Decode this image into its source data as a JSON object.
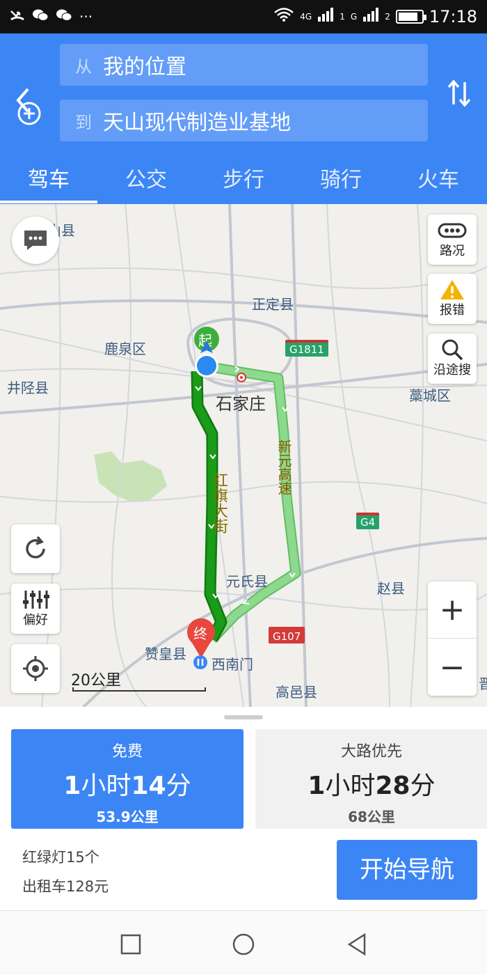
{
  "status_bar": {
    "left_icons": [
      "missed-call-icon",
      "wechat-icon",
      "wechat-icon",
      "more-dots-icon"
    ],
    "more": "···",
    "net1": "4G",
    "net2": "G",
    "sim1": "1",
    "sim2": "2",
    "battery_level": 0.85,
    "time": "17:18"
  },
  "header": {
    "from_prefix": "从",
    "from_value": "我的位置",
    "to_prefix": "到",
    "to_value": "天山现代制造业基地"
  },
  "tabs": [
    {
      "label": "驾车",
      "active": true
    },
    {
      "label": "公交",
      "active": false
    },
    {
      "label": "步行",
      "active": false
    },
    {
      "label": "骑行",
      "active": false
    },
    {
      "label": "火车",
      "active": false
    }
  ],
  "map": {
    "labels": {
      "shan_county": "山县",
      "zhengding": "正定县",
      "luquan": "鹿泉区",
      "jingxing": "井陉县",
      "shijiazhuang": "石家庄",
      "gaocheng": "藁城区",
      "yuanshi": "元氏县",
      "zhaoxian": "赵县",
      "zanhuang": "赞皇县",
      "xinanmen": "西南门",
      "gaoyi": "高邑县",
      "jin": "晋"
    },
    "roads": {
      "hongqi": "红旗大街",
      "xinyuan": "新元高速",
      "g1811": "G1811",
      "g4": "G4",
      "g107": "G107"
    },
    "markers": {
      "start": "起",
      "end": "终"
    },
    "buttons": {
      "traffic": "路况",
      "report": "报错",
      "search_along": "沿途搜",
      "preference": "偏好"
    },
    "zoom_in": "+",
    "zoom_out": "−",
    "scale": "20公里",
    "route_colors": {
      "selected": "#1a9b1a",
      "alternative": "#8fd88f"
    }
  },
  "routes": [
    {
      "name": "免费",
      "time_h": "1",
      "time_h_unit": "小时",
      "time_m": "14",
      "time_m_unit": "分",
      "distance": "53.9公里",
      "selected": true
    },
    {
      "name": "大路优先",
      "time_h": "1",
      "time_h_unit": "小时",
      "time_m": "28",
      "time_m_unit": "分",
      "distance": "68公里",
      "selected": false
    }
  ],
  "info": {
    "traffic_lights": "红绿灯15个",
    "taxi": "出租车128元"
  },
  "start_nav": "开始导航",
  "colors": {
    "accent": "#3c85f5"
  }
}
